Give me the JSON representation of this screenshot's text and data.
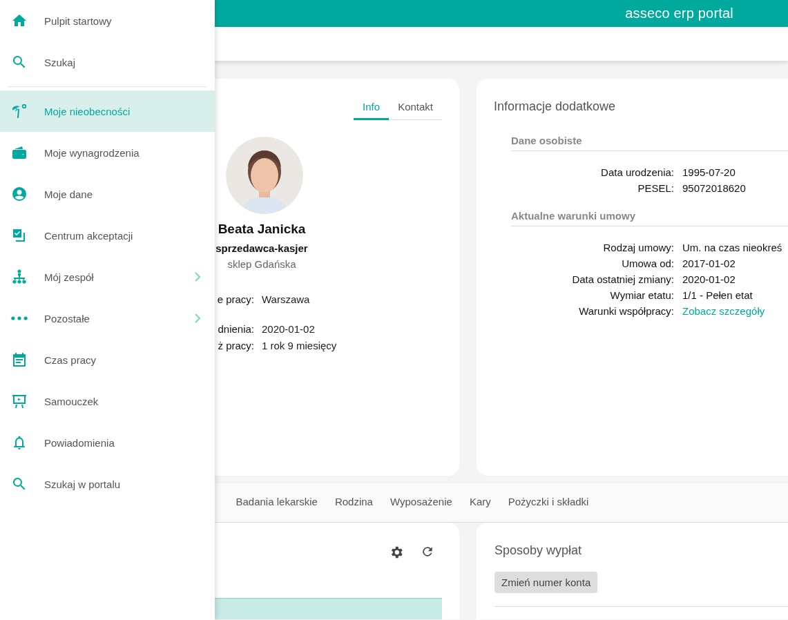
{
  "header": {
    "brand": "asseco erp portal"
  },
  "sidebar": {
    "sections": [
      {
        "items": [
          {
            "label": "Pulpit startowy",
            "selected": false,
            "has_submenu": false
          },
          {
            "label": "Szukaj",
            "selected": false,
            "has_submenu": false
          }
        ]
      },
      {
        "items": [
          {
            "label": "Moje nieobecności",
            "selected": true,
            "has_submenu": false
          },
          {
            "label": "Moje wynagrodzenia",
            "selected": false,
            "has_submenu": false
          },
          {
            "label": "Moje dane",
            "selected": false,
            "has_submenu": false
          },
          {
            "label": "Centrum akceptacji",
            "selected": false,
            "has_submenu": false
          },
          {
            "label": "Mój zespół",
            "selected": false,
            "has_submenu": true
          },
          {
            "label": "Pozostałe",
            "selected": false,
            "has_submenu": true
          },
          {
            "label": "Czas pracy",
            "selected": false,
            "has_submenu": false
          },
          {
            "label": "Samouczek",
            "selected": false,
            "has_submenu": false
          },
          {
            "label": "Powiadomienia",
            "selected": false,
            "has_submenu": false
          },
          {
            "label": "Szukaj w portalu",
            "selected": false,
            "has_submenu": false
          }
        ]
      }
    ]
  },
  "profile": {
    "tabs": [
      {
        "label": "Info",
        "selected": true
      },
      {
        "label": "Kontakt",
        "selected": false
      }
    ],
    "name": "Beata Janicka",
    "position": "sprzedawca-kasjer",
    "location": "sklep Gdańska",
    "field_groups": [
      [
        {
          "label": "e pracy:",
          "value": "Warszawa"
        }
      ],
      [
        {
          "label": "dnienia:",
          "value": "2020-01-02"
        },
        {
          "label": "ż pracy:",
          "value": "1 rok 9 miesięcy"
        }
      ]
    ]
  },
  "info": {
    "title": "Informacje dodatkowe",
    "sections": [
      {
        "title": "Dane osobiste",
        "rows": [
          {
            "label": "Data urodzenia:",
            "value": "1995-07-20",
            "kind": "text"
          },
          {
            "label": "PESEL:",
            "value": "95072018620",
            "kind": "text"
          }
        ]
      },
      {
        "title": "Aktualne warunki umowy",
        "rows": [
          {
            "label": "Rodzaj umowy:",
            "value": "Um. na czas nieokreś",
            "kind": "text"
          },
          {
            "label": "Umowa od:",
            "value": "2017-01-02",
            "kind": "text"
          },
          {
            "label": "Data ostatniej zmiany:",
            "value": "2020-01-02",
            "kind": "text"
          },
          {
            "label": "Wymiar etatu:",
            "value": "1/1 - Pełen etat",
            "kind": "text"
          },
          {
            "label": "Warunki współpracy:",
            "value": "Zobacz szczegóły",
            "kind": "link"
          }
        ]
      }
    ]
  },
  "section_tabs": [
    {
      "label": "Badania lekarskie",
      "selected": false
    },
    {
      "label": "Rodzina",
      "selected": false
    },
    {
      "label": "Wyposażenie",
      "selected": false
    },
    {
      "label": "Kary",
      "selected": false
    },
    {
      "label": "Pożyczki i składki",
      "selected": false
    }
  ],
  "payouts": {
    "title": "Sposoby wypłat",
    "button": "Zmień numer konta"
  }
}
